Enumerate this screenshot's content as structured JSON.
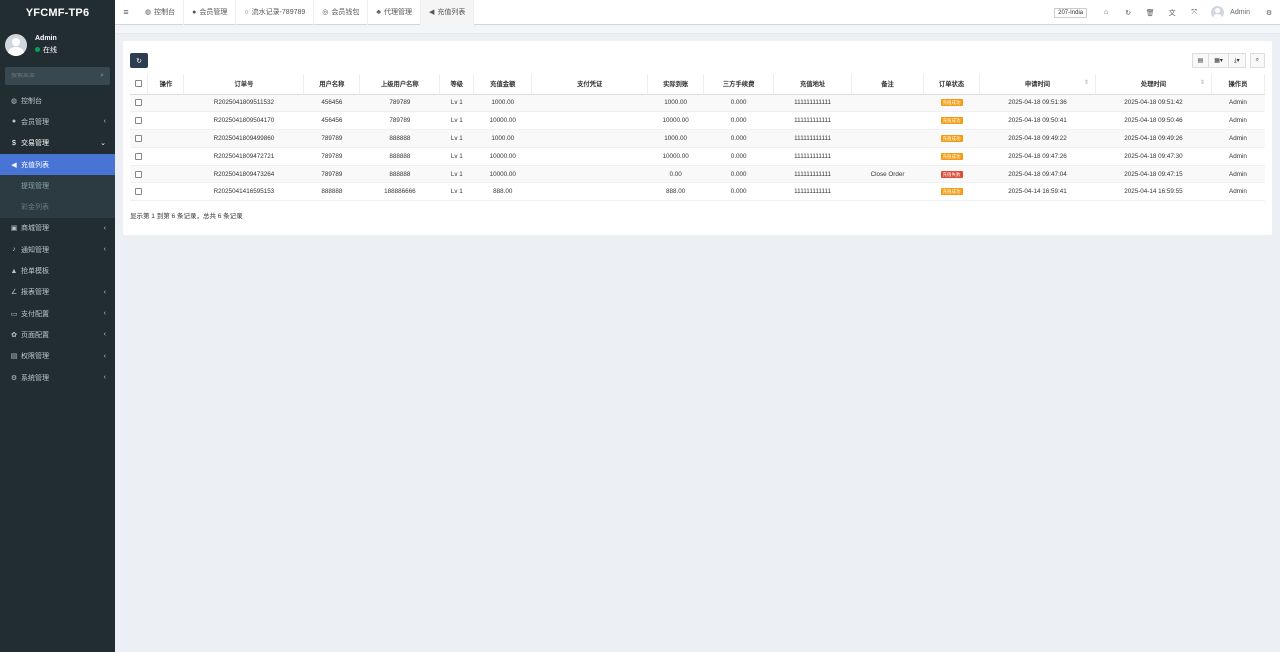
{
  "app": {
    "logo_bold": "YFCM",
    "logo_rest": "F-TP6"
  },
  "user": {
    "name": "Admin",
    "status": "在线"
  },
  "sidebar": {
    "search_placeholder": "搜索菜单",
    "items": [
      {
        "icon": "◍",
        "label": "控制台",
        "arrow": ""
      },
      {
        "icon": "●",
        "label": "会员管理",
        "arrow": "‹"
      },
      {
        "icon": "$",
        "label": "交易管理",
        "arrow": "⌄"
      },
      {
        "icon": "◀",
        "label": "充值列表",
        "arrow": ""
      },
      {
        "icon": "",
        "label": "提现管理",
        "arrow": ""
      },
      {
        "icon": "",
        "label": "彩金列表",
        "arrow": ""
      },
      {
        "icon": "▣",
        "label": "商城管理",
        "arrow": "‹"
      },
      {
        "icon": "♪",
        "label": "通知管理",
        "arrow": "‹"
      },
      {
        "icon": "▲",
        "label": "抢单模板",
        "arrow": ""
      },
      {
        "icon": "∠",
        "label": "报表管理",
        "arrow": "‹"
      },
      {
        "icon": "▭",
        "label": "支付配置",
        "arrow": "‹"
      },
      {
        "icon": "✿",
        "label": "页面配置",
        "arrow": "‹"
      },
      {
        "icon": "▤",
        "label": "权限管理",
        "arrow": "‹"
      },
      {
        "icon": "⚙",
        "label": "系统管理",
        "arrow": "‹"
      }
    ]
  },
  "topbar": {
    "tabs": [
      {
        "icon": "◍",
        "label": "控制台"
      },
      {
        "icon": "●",
        "label": "会员管理"
      },
      {
        "icon": "○",
        "label": "流水记录-789789"
      },
      {
        "icon": "◎",
        "label": "会员钱包"
      },
      {
        "icon": "♣",
        "label": "代理管理"
      },
      {
        "icon": "◀",
        "label": "充值列表"
      }
    ],
    "region": "207-India",
    "icons": {
      "home": "⌂",
      "refresh": "↻",
      "trash": "🗑",
      "translate": "文",
      "fullscreen": "⤧",
      "settings": "⚙"
    },
    "user": "Admin"
  },
  "toolbar": {
    "refresh": "↻",
    "view_toggle": "▤",
    "columns": "▦▾",
    "export": "⤓▾",
    "search": "⌕"
  },
  "table": {
    "headers": [
      "操作",
      "订单号",
      "用户名称",
      "上级用户名称",
      "等级",
      "充值金额",
      "支付凭证",
      "实际到账",
      "三方手续费",
      "充值地址",
      "备注",
      "订单状态",
      "申请时间",
      "处理时间",
      "操作员"
    ],
    "rows": [
      [
        "",
        "R2025041809511532",
        "456456",
        "789789",
        "Lv 1",
        "1000.00",
        "",
        "1000.00",
        "0.000",
        "111111111111",
        "",
        "充值成功",
        "2025-04-18 09:51:36",
        "2025-04-18 09:51:42",
        "Admin"
      ],
      [
        "",
        "R2025041809504170",
        "456456",
        "789789",
        "Lv 1",
        "10000.00",
        "",
        "10000.00",
        "0.000",
        "111111111111",
        "",
        "充值成功",
        "2025-04-18 09:50:41",
        "2025-04-18 09:50:46",
        "Admin"
      ],
      [
        "",
        "R2025041809499860",
        "789789",
        "888888",
        "Lv 1",
        "1000.00",
        "",
        "1000.00",
        "0.000",
        "111111111111",
        "",
        "充值成功",
        "2025-04-18 09:49:22",
        "2025-04-18 09:49:26",
        "Admin"
      ],
      [
        "",
        "R2025041809472721",
        "789789",
        "888888",
        "Lv 1",
        "10000.00",
        "",
        "10000.00",
        "0.000",
        "111111111111",
        "",
        "充值成功",
        "2025-04-18 09:47:26",
        "2025-04-18 09:47:30",
        "Admin"
      ],
      [
        "",
        "R2025041809473264",
        "789789",
        "888888",
        "Lv 1",
        "10000.00",
        "",
        "0.00",
        "0.000",
        "111111111111",
        "Close Order",
        "充值失败",
        "2025-04-18 09:47:04",
        "2025-04-18 09:47:15",
        "Admin"
      ],
      [
        "",
        "R2025041416595153",
        "888888",
        "188886666",
        "Lv 1",
        "888.00",
        "",
        "888.00",
        "0.000",
        "111111111111",
        "",
        "充值成功",
        "2025-04-14 16:59:41",
        "2025-04-14 16:59:55",
        "Admin"
      ]
    ],
    "status_colors": {
      "充值成功": "#f39c12",
      "充值失败": "#dd4b39"
    }
  },
  "footer": {
    "summary": "显示第 1 到第 6 条记录，总共 6 条记录"
  }
}
